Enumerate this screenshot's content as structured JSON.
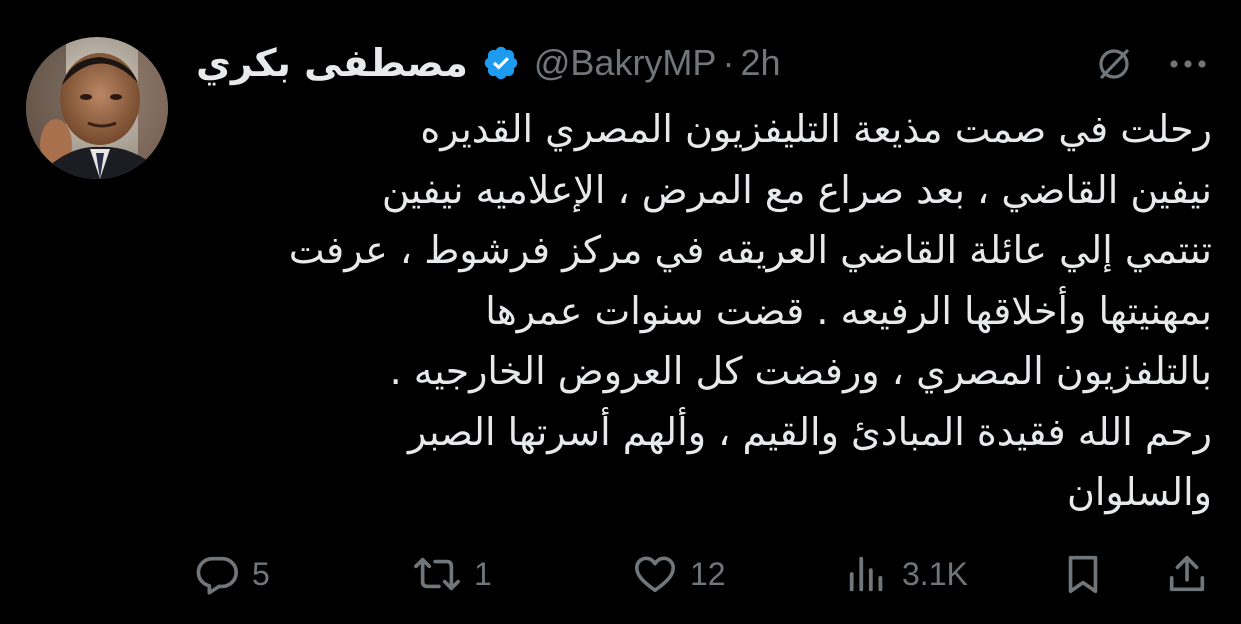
{
  "colors": {
    "background": "#000000",
    "text_primary": "#e7e9ea",
    "text_secondary": "#71767b",
    "verified_badge": "#1d9bf0"
  },
  "author": {
    "display_name": "مصطفى بكري",
    "verified_icon": "verified-badge-icon",
    "handle": "@BakryMP",
    "separator": "·",
    "time": "2h"
  },
  "header_icons": [
    "grok-icon",
    "more-icon"
  ],
  "tweet": {
    "lines": [
      "رحلت في صمت مذيعة التليفزيون المصري القديره",
      "نيفين القاضي ، بعد صراع مع المرض ، الإعلاميه نيفين",
      "تنتمي إلي عائلة القاضي العريقه في مركز فرشوط ، عرفت",
      "بمهنيتها وأخلاقها الرفيعه . قضت سنوات عمرها",
      "بالتلفزيون المصري ، ورفضت كل العروض الخارجيه .",
      "رحم الله فقيدة المبادئ والقيم ، وألهم أسرتها الصبر",
      "والسلوان"
    ]
  },
  "actions": {
    "reply": {
      "icon": "reply-icon",
      "count": "5"
    },
    "retweet": {
      "icon": "retweet-icon",
      "count": "1"
    },
    "like": {
      "icon": "heart-icon",
      "count": "12"
    },
    "views": {
      "icon": "views-icon",
      "count": "3.1K"
    },
    "bookmark": {
      "icon": "bookmark-icon"
    },
    "share": {
      "icon": "share-icon"
    }
  }
}
